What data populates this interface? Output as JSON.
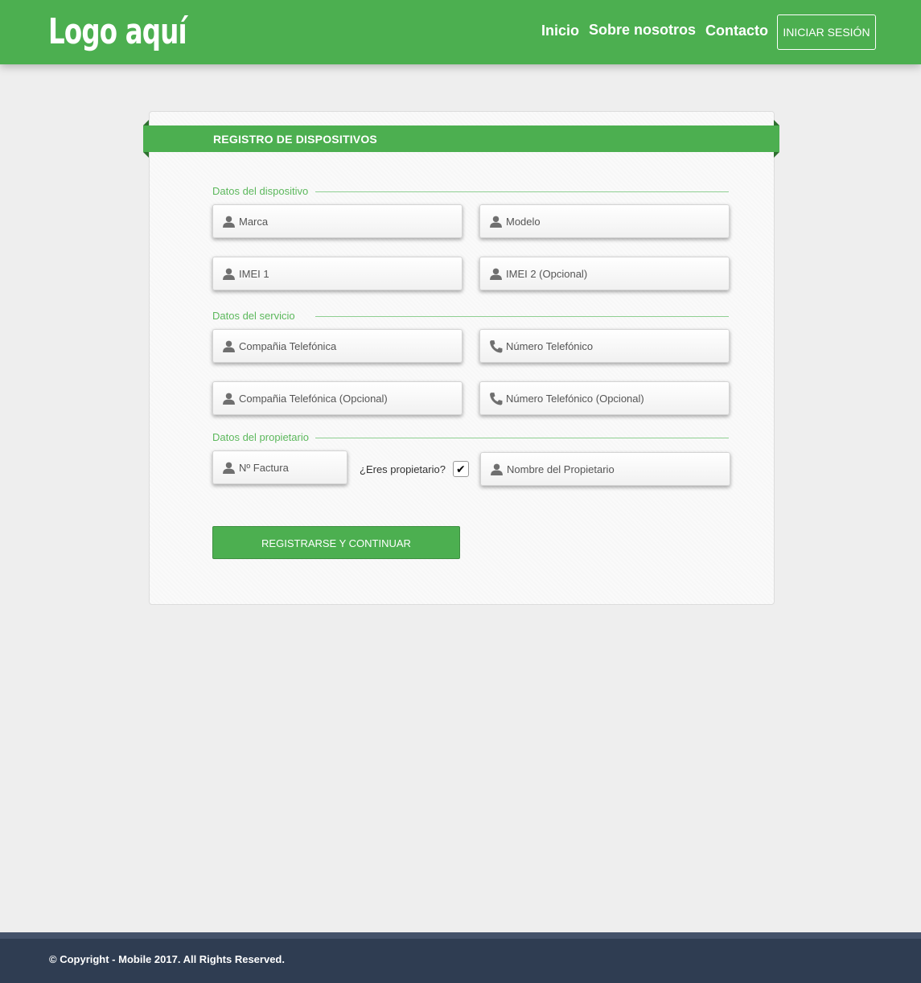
{
  "header": {
    "logo": "Logo aquí",
    "nav": [
      "Inicio",
      "Sobre nosotros",
      "Contacto"
    ],
    "login_label": "INICIAR SESIÓN",
    "bg_color": "#4caf50"
  },
  "form": {
    "title": "REGISTRO DE DISPOSITIVOS",
    "sections": {
      "device": "Datos del dispositivo",
      "service": "Datos del servicio",
      "owner": "Datos del propietario"
    },
    "placeholders": {
      "marca": "Marca",
      "modelo": "Modelo",
      "imei1": "IMEI 1",
      "imei2": "IMEI 2 (Opcional)",
      "company": "Compañia Telefónica",
      "phone": "Número Telefónico",
      "company2": "Compañia Telefónica (Opcional)",
      "phone2": "Número Telefónico (Opcional)",
      "invoice": "Nº Factura",
      "owner_name": "Nombre del Propietario"
    },
    "owner_question": "¿Eres propietario?",
    "owner_checked": true,
    "checkmark": "✔",
    "submit_label": "REGISTRARSE Y CONTINUAR",
    "icons": {
      "person": "person-icon",
      "phone": "phone-icon"
    }
  },
  "footer": {
    "copyright": "© Copyright - Mobile 2017. All Rights Reserved.",
    "bg_color": "#2f3d52"
  }
}
